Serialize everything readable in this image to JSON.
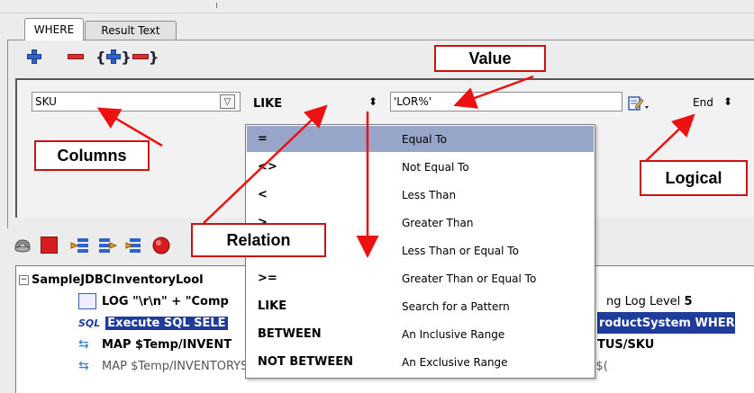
{
  "tabs": {
    "where": "WHERE",
    "result": "Result Text"
  },
  "toolbar": {
    "add_icon": "plus-icon",
    "remove_icon": "minus-icon",
    "add_group_icon": "brace-plus-icon",
    "remove_group_icon": "brace-minus-icon"
  },
  "condition": {
    "column": "SKU",
    "relation": "LIKE",
    "value": "'LOR%'",
    "logical": "End"
  },
  "relation_options": [
    {
      "symbol": "=",
      "desc": "Equal To",
      "selected": true
    },
    {
      "symbol": "<>",
      "desc": "Not Equal To"
    },
    {
      "symbol": "<",
      "desc": "Less Than"
    },
    {
      "symbol": ">",
      "desc": "Greater Than"
    },
    {
      "symbol": "<=",
      "desc": "Less Than or Equal To"
    },
    {
      "symbol": ">=",
      "desc": "Greater Than or Equal To"
    },
    {
      "symbol": "LIKE",
      "desc": "Search for a Pattern"
    },
    {
      "symbol": "BETWEEN",
      "desc": "An Inclusive Range"
    },
    {
      "symbol": "NOT BETWEEN",
      "desc": "An Exclusive Range"
    }
  ],
  "callouts": {
    "value": "Value",
    "columns": "Columns",
    "relation": "Relation",
    "logical": "Logical"
  },
  "tree": {
    "root": "SampleJDBCInventoryLool",
    "row1_left": "LOG \"\\r\\n\" + \"Comp",
    "row1_right": "ng Log Level",
    "row1_level": "5",
    "row2_left": "Execute SQL SELE",
    "row2_right": "roductSystem WHER",
    "row3_left": "MAP $Temp/INVENT",
    "row3_right": "TUS/SKU",
    "row4_left": "MAP $Temp/INVENTORYSTATUS/CATEGORY Via Code Table Map InventoryDisplay TO $("
  },
  "colors": {
    "accent_red": "#cc1111",
    "selection_blue": "#1f3c9b",
    "option_highlight": "#97a6c8"
  }
}
